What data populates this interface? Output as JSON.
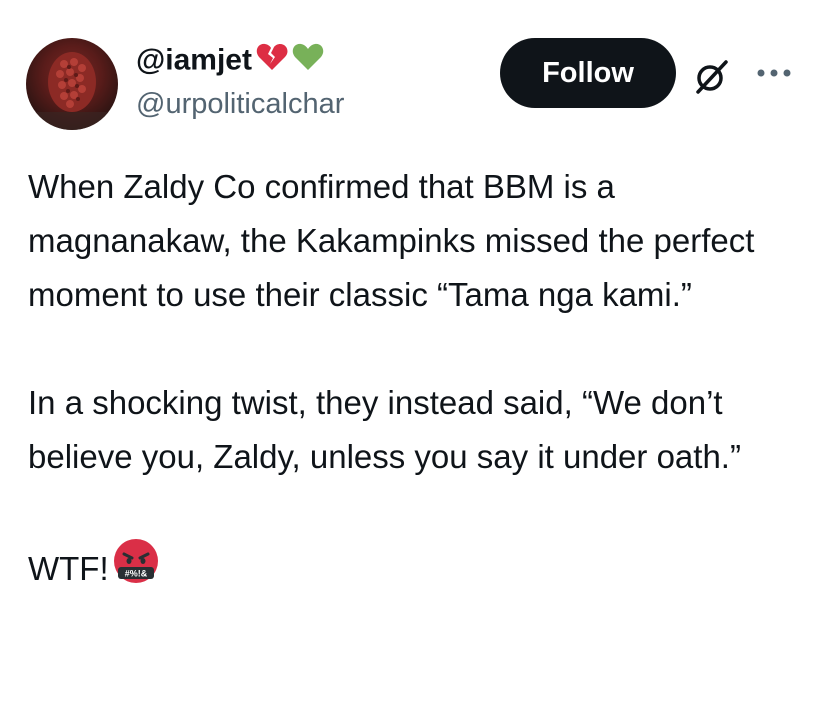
{
  "author": {
    "display_name": "@iamjet",
    "badges": [
      "broken-heart-emoji",
      "green-heart-emoji"
    ],
    "handle": "@urpoliticalchar"
  },
  "actions": {
    "follow_label": "Follow",
    "grok_icon": "grok-icon",
    "more_icon": "more-icon"
  },
  "tweet": {
    "paragraph_1": "When Zaldy Co confirmed that BBM is a magnanakaw, the Kakampinks missed the perfect moment to use their classic “Tama nga kami.”",
    "paragraph_2": "In a shocking twist, they instead said, “We don’t believe you, Zaldy, unless you say it under oath.”",
    "paragraph_3": "WTF!",
    "emoji_text": "#%!&"
  },
  "colors": {
    "text": "#0f1419",
    "secondary_text": "#536471",
    "follow_bg": "#0f1419",
    "follow_text": "#ffffff",
    "broken_heart": "#dd2e44",
    "green_heart": "#78b159",
    "angry_face": "#da2f47"
  }
}
